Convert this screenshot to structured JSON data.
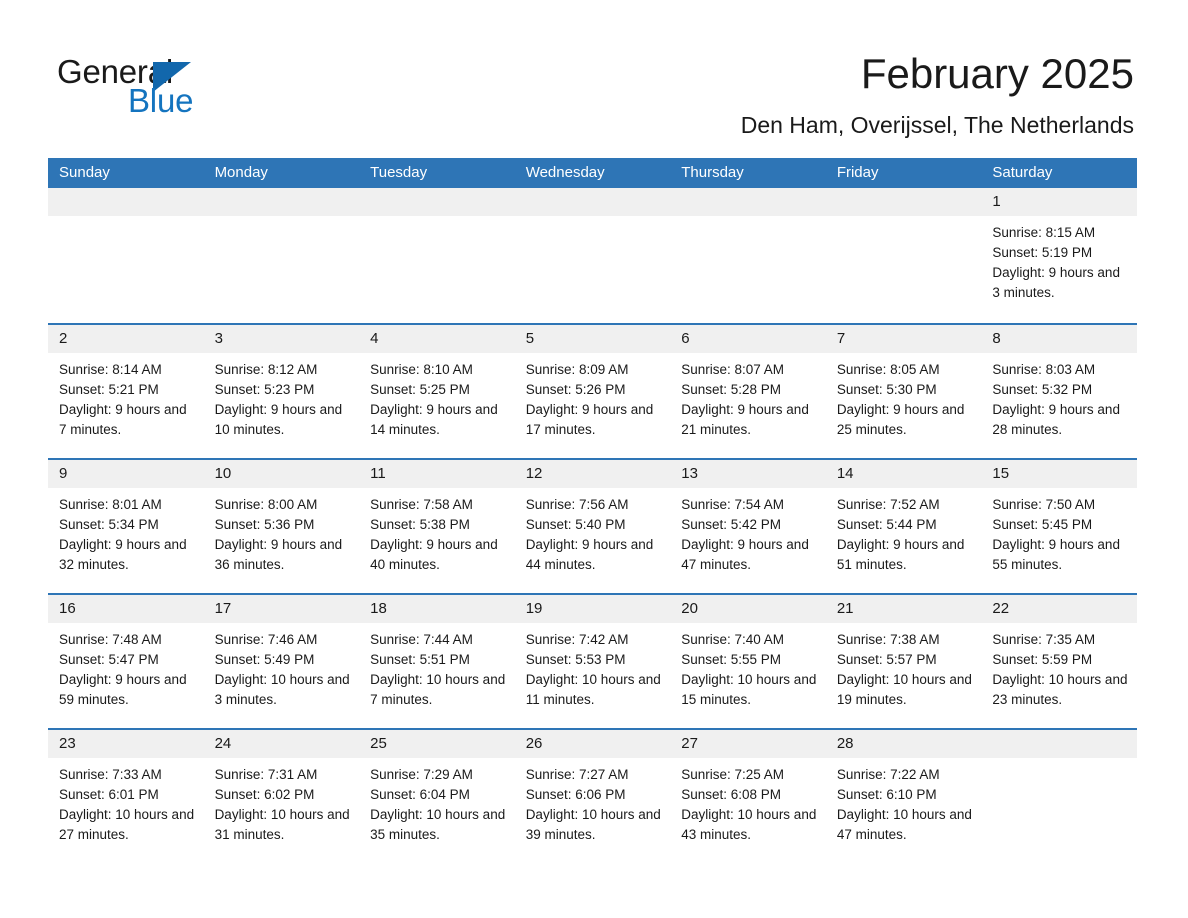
{
  "brand": {
    "name_part1": "General",
    "name_part2": "Blue",
    "triangle_icon": "triangle-icon",
    "accent_blue": "#1474bf",
    "logo_triangle_blue": "#1267ac"
  },
  "header": {
    "title": "February 2025",
    "subtitle": "Den Ham, Overijssel, The Netherlands"
  },
  "theme": {
    "header_blue": "#2e75b6",
    "day_band_gray": "#f0f0f0",
    "text": "#1a1a1a",
    "page_background": "#ffffff"
  },
  "weekdays": [
    "Sunday",
    "Monday",
    "Tuesday",
    "Wednesday",
    "Thursday",
    "Friday",
    "Saturday"
  ],
  "weeks": [
    [
      {
        "day": "",
        "empty": true
      },
      {
        "day": "",
        "empty": true
      },
      {
        "day": "",
        "empty": true
      },
      {
        "day": "",
        "empty": true
      },
      {
        "day": "",
        "empty": true
      },
      {
        "day": "",
        "empty": true
      },
      {
        "day": "1",
        "sunrise": "Sunrise: 8:15 AM",
        "sunset": "Sunset: 5:19 PM",
        "daylight": "Daylight: 9 hours and 3 minutes."
      }
    ],
    [
      {
        "day": "2",
        "sunrise": "Sunrise: 8:14 AM",
        "sunset": "Sunset: 5:21 PM",
        "daylight": "Daylight: 9 hours and 7 minutes."
      },
      {
        "day": "3",
        "sunrise": "Sunrise: 8:12 AM",
        "sunset": "Sunset: 5:23 PM",
        "daylight": "Daylight: 9 hours and 10 minutes."
      },
      {
        "day": "4",
        "sunrise": "Sunrise: 8:10 AM",
        "sunset": "Sunset: 5:25 PM",
        "daylight": "Daylight: 9 hours and 14 minutes."
      },
      {
        "day": "5",
        "sunrise": "Sunrise: 8:09 AM",
        "sunset": "Sunset: 5:26 PM",
        "daylight": "Daylight: 9 hours and 17 minutes."
      },
      {
        "day": "6",
        "sunrise": "Sunrise: 8:07 AM",
        "sunset": "Sunset: 5:28 PM",
        "daylight": "Daylight: 9 hours and 21 minutes."
      },
      {
        "day": "7",
        "sunrise": "Sunrise: 8:05 AM",
        "sunset": "Sunset: 5:30 PM",
        "daylight": "Daylight: 9 hours and 25 minutes."
      },
      {
        "day": "8",
        "sunrise": "Sunrise: 8:03 AM",
        "sunset": "Sunset: 5:32 PM",
        "daylight": "Daylight: 9 hours and 28 minutes."
      }
    ],
    [
      {
        "day": "9",
        "sunrise": "Sunrise: 8:01 AM",
        "sunset": "Sunset: 5:34 PM",
        "daylight": "Daylight: 9 hours and 32 minutes."
      },
      {
        "day": "10",
        "sunrise": "Sunrise: 8:00 AM",
        "sunset": "Sunset: 5:36 PM",
        "daylight": "Daylight: 9 hours and 36 minutes."
      },
      {
        "day": "11",
        "sunrise": "Sunrise: 7:58 AM",
        "sunset": "Sunset: 5:38 PM",
        "daylight": "Daylight: 9 hours and 40 minutes."
      },
      {
        "day": "12",
        "sunrise": "Sunrise: 7:56 AM",
        "sunset": "Sunset: 5:40 PM",
        "daylight": "Daylight: 9 hours and 44 minutes."
      },
      {
        "day": "13",
        "sunrise": "Sunrise: 7:54 AM",
        "sunset": "Sunset: 5:42 PM",
        "daylight": "Daylight: 9 hours and 47 minutes."
      },
      {
        "day": "14",
        "sunrise": "Sunrise: 7:52 AM",
        "sunset": "Sunset: 5:44 PM",
        "daylight": "Daylight: 9 hours and 51 minutes."
      },
      {
        "day": "15",
        "sunrise": "Sunrise: 7:50 AM",
        "sunset": "Sunset: 5:45 PM",
        "daylight": "Daylight: 9 hours and 55 minutes."
      }
    ],
    [
      {
        "day": "16",
        "sunrise": "Sunrise: 7:48 AM",
        "sunset": "Sunset: 5:47 PM",
        "daylight": "Daylight: 9 hours and 59 minutes."
      },
      {
        "day": "17",
        "sunrise": "Sunrise: 7:46 AM",
        "sunset": "Sunset: 5:49 PM",
        "daylight": "Daylight: 10 hours and 3 minutes."
      },
      {
        "day": "18",
        "sunrise": "Sunrise: 7:44 AM",
        "sunset": "Sunset: 5:51 PM",
        "daylight": "Daylight: 10 hours and 7 minutes."
      },
      {
        "day": "19",
        "sunrise": "Sunrise: 7:42 AM",
        "sunset": "Sunset: 5:53 PM",
        "daylight": "Daylight: 10 hours and 11 minutes."
      },
      {
        "day": "20",
        "sunrise": "Sunrise: 7:40 AM",
        "sunset": "Sunset: 5:55 PM",
        "daylight": "Daylight: 10 hours and 15 minutes."
      },
      {
        "day": "21",
        "sunrise": "Sunrise: 7:38 AM",
        "sunset": "Sunset: 5:57 PM",
        "daylight": "Daylight: 10 hours and 19 minutes."
      },
      {
        "day": "22",
        "sunrise": "Sunrise: 7:35 AM",
        "sunset": "Sunset: 5:59 PM",
        "daylight": "Daylight: 10 hours and 23 minutes."
      }
    ],
    [
      {
        "day": "23",
        "sunrise": "Sunrise: 7:33 AM",
        "sunset": "Sunset: 6:01 PM",
        "daylight": "Daylight: 10 hours and 27 minutes."
      },
      {
        "day": "24",
        "sunrise": "Sunrise: 7:31 AM",
        "sunset": "Sunset: 6:02 PM",
        "daylight": "Daylight: 10 hours and 31 minutes."
      },
      {
        "day": "25",
        "sunrise": "Sunrise: 7:29 AM",
        "sunset": "Sunset: 6:04 PM",
        "daylight": "Daylight: 10 hours and 35 minutes."
      },
      {
        "day": "26",
        "sunrise": "Sunrise: 7:27 AM",
        "sunset": "Sunset: 6:06 PM",
        "daylight": "Daylight: 10 hours and 39 minutes."
      },
      {
        "day": "27",
        "sunrise": "Sunrise: 7:25 AM",
        "sunset": "Sunset: 6:08 PM",
        "daylight": "Daylight: 10 hours and 43 minutes."
      },
      {
        "day": "28",
        "sunrise": "Sunrise: 7:22 AM",
        "sunset": "Sunset: 6:10 PM",
        "daylight": "Daylight: 10 hours and 47 minutes."
      },
      {
        "day": "",
        "empty": true,
        "trailing": true
      }
    ]
  ]
}
